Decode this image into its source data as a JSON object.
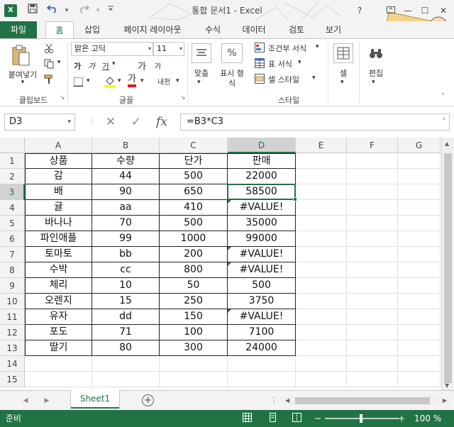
{
  "window": {
    "title": "통합 문서1 - Excel",
    "help": "?",
    "app_icon": "X"
  },
  "tabs": [
    "파일",
    "홈",
    "삽입",
    "페이지 레이아웃",
    "수식",
    "데이터",
    "검토",
    "보기"
  ],
  "ribbon": {
    "paste_label": "붙여넣기",
    "clipboard_group": "클립보드",
    "font_name": "맑은 고딕",
    "font_size": "11",
    "bold": "가",
    "italic": "가",
    "underline": "가",
    "font_color_glyph": "가",
    "increase_font": "가",
    "decrease_font": "가",
    "phonetic": "내천",
    "font_group": "글꼴",
    "align_label": "맞춤",
    "number_label_line1": "표시 형",
    "number_label_line2": "식",
    "percent": "%",
    "cond_format": "조건부 서식",
    "table_format": "표 서식",
    "cell_style": "셀 스타일",
    "style_group": "스타일",
    "cells_label": "셀",
    "edit_label": "편집"
  },
  "formula_bar": {
    "name_box": "D3",
    "fx": "fx",
    "cancel": "✕",
    "enter": "✓",
    "formula": "=B3*C3"
  },
  "columns": [
    "A",
    "B",
    "C",
    "D",
    "E",
    "F",
    "G"
  ],
  "rows": [
    {
      "n": "1",
      "a": "상품",
      "b": "수량",
      "c": "단가",
      "d": "판매",
      "err": false
    },
    {
      "n": "2",
      "a": "감",
      "b": "44",
      "c": "500",
      "d": "22000",
      "err": false
    },
    {
      "n": "3",
      "a": "배",
      "b": "90",
      "c": "650",
      "d": "58500",
      "err": false
    },
    {
      "n": "4",
      "a": "귤",
      "b": "aa",
      "c": "410",
      "d": "#VALUE!",
      "err": true
    },
    {
      "n": "5",
      "a": "바나나",
      "b": "70",
      "c": "500",
      "d": "35000",
      "err": false
    },
    {
      "n": "6",
      "a": "파인애플",
      "b": "99",
      "c": "1000",
      "d": "99000",
      "err": false
    },
    {
      "n": "7",
      "a": "토마토",
      "b": "bb",
      "c": "200",
      "d": "#VALUE!",
      "err": true
    },
    {
      "n": "8",
      "a": "수박",
      "b": "cc",
      "c": "800",
      "d": "#VALUE!",
      "err": true
    },
    {
      "n": "9",
      "a": "체리",
      "b": "10",
      "c": "50",
      "d": "500",
      "err": false
    },
    {
      "n": "10",
      "a": "오렌지",
      "b": "15",
      "c": "250",
      "d": "3750",
      "err": false
    },
    {
      "n": "11",
      "a": "유자",
      "b": "dd",
      "c": "150",
      "d": "#VALUE!",
      "err": true
    },
    {
      "n": "12",
      "a": "포도",
      "b": "71",
      "c": "100",
      "d": "7100",
      "err": false
    },
    {
      "n": "13",
      "a": "딸기",
      "b": "80",
      "c": "300",
      "d": "24000",
      "err": false
    },
    {
      "n": "14",
      "a": "",
      "b": "",
      "c": "",
      "d": "",
      "err": false
    },
    {
      "n": "15",
      "a": "",
      "b": "",
      "c": "",
      "d": "",
      "err": false
    }
  ],
  "sheet": {
    "tab": "Sheet1",
    "add": "+"
  },
  "status": {
    "text": "준비",
    "zoom": "100 %",
    "zoom_minus": "−",
    "zoom_plus": "+"
  },
  "colors": {
    "accent": "#217346",
    "error_triangle": "#1f7a3a"
  }
}
